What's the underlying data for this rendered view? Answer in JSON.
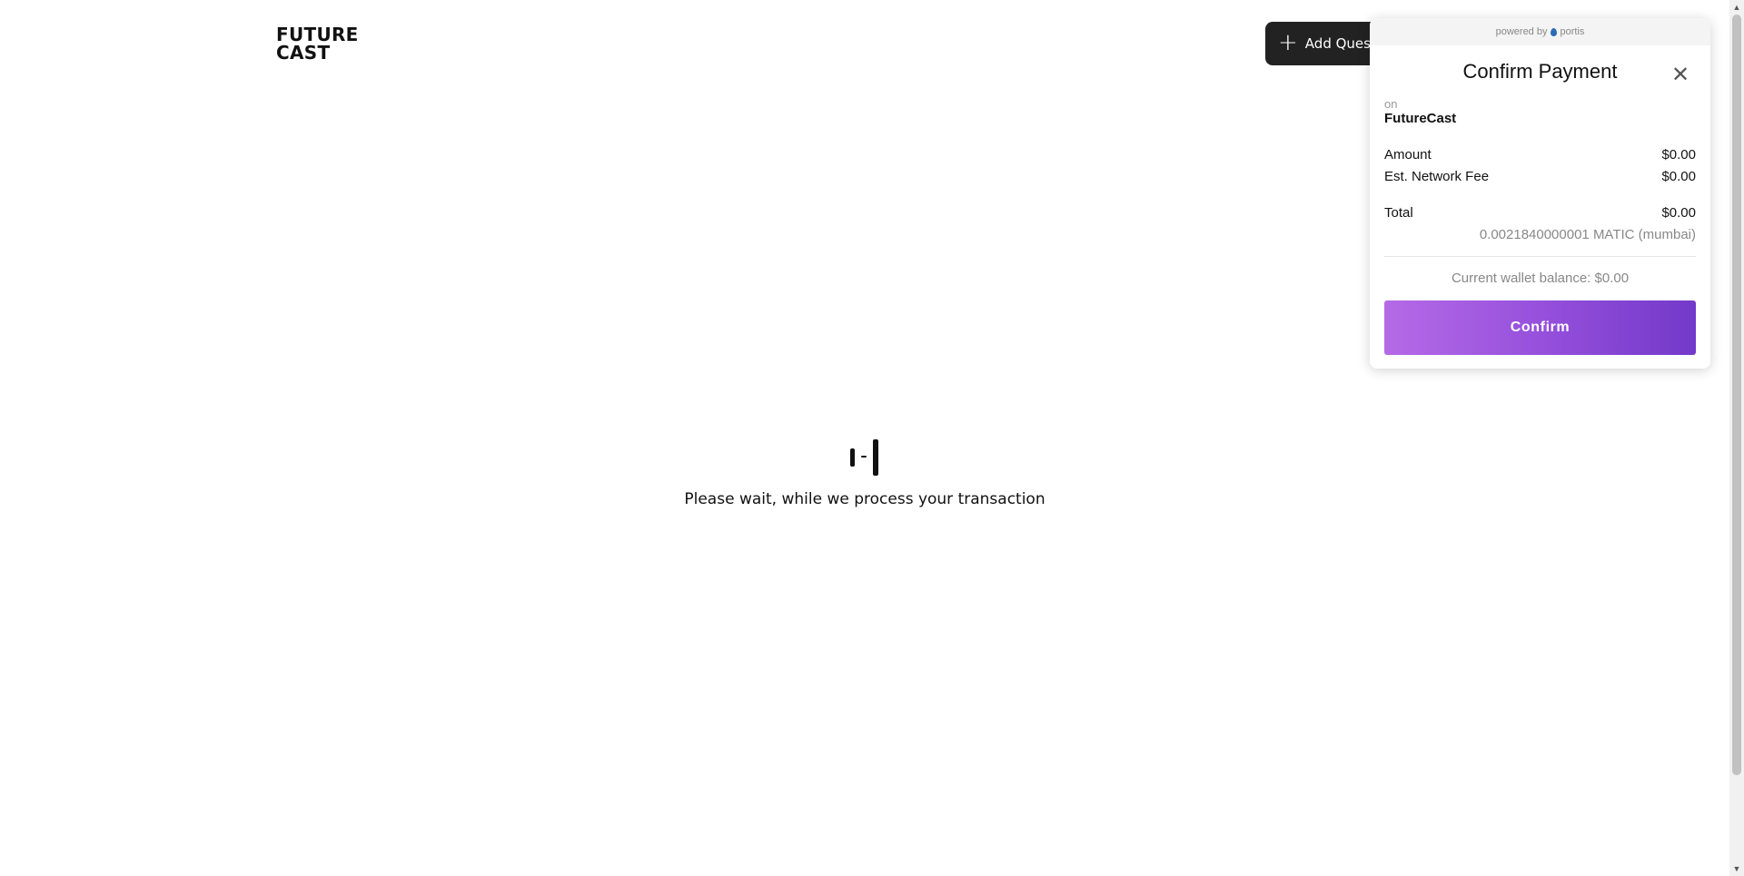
{
  "header": {
    "logo_line1": "FUTURE",
    "logo_line2": "CAST",
    "add_button_icon": "plus-icon",
    "add_button_label": "Add Quest"
  },
  "main": {
    "loader_icon": "loading-bars-icon",
    "status_text": "Please wait, while we process your transaction"
  },
  "modal": {
    "powered_by": "powered by",
    "provider": "portis",
    "provider_icon": "portis-drop-icon",
    "title": "Confirm Payment",
    "close_icon": "close-icon",
    "on_label": "on",
    "app_name": "FutureCast",
    "amount_label": "Amount",
    "amount_value": "$0.00",
    "fee_label": "Est. Network Fee",
    "fee_value": "$0.00",
    "total_label": "Total",
    "total_value": "$0.00",
    "matic_amount": "0.0021840000001  MATIC (mumbai)",
    "balance": "Current wallet balance: $0.00",
    "confirm_label": "Confirm",
    "confirm_gradient": [
      "#b56ae6",
      "#7339c9"
    ]
  },
  "scrollbar": {
    "up_icon": "scroll-up-icon",
    "down_icon": "scroll-down-icon"
  }
}
